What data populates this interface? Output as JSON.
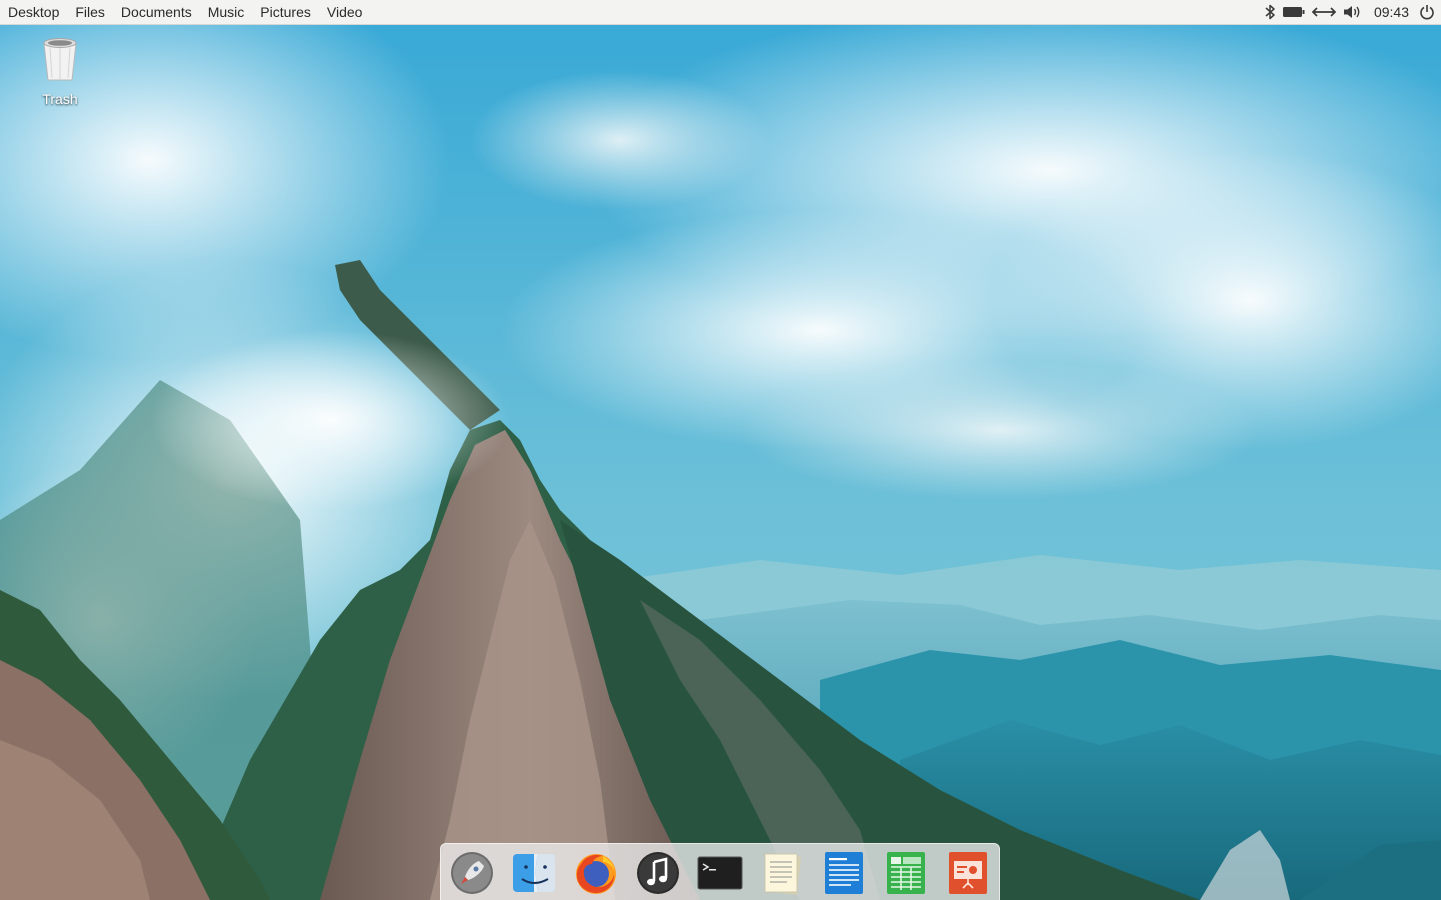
{
  "topbar": {
    "places": [
      {
        "label": "Desktop"
      },
      {
        "label": "Files"
      },
      {
        "label": "Documents"
      },
      {
        "label": "Music"
      },
      {
        "label": "Pictures"
      },
      {
        "label": "Video"
      }
    ],
    "tray_icons": [
      "bluetooth-icon",
      "battery-icon",
      "network-icon",
      "volume-icon",
      "power-icon"
    ],
    "clock": "09:43"
  },
  "desktop": {
    "icons": [
      {
        "label": "Trash",
        "icon": "trash-icon"
      }
    ]
  },
  "dock": {
    "apps": [
      {
        "name": "launcher",
        "icon": "rocket-icon"
      },
      {
        "name": "files",
        "icon": "finder-icon"
      },
      {
        "name": "firefox",
        "icon": "firefox-icon"
      },
      {
        "name": "music",
        "icon": "music-icon"
      },
      {
        "name": "terminal",
        "icon": "terminal-icon"
      },
      {
        "name": "text-editor",
        "icon": "notes-icon"
      },
      {
        "name": "writer",
        "icon": "document-icon"
      },
      {
        "name": "spreadsheet",
        "icon": "spreadsheet-icon"
      },
      {
        "name": "presentation",
        "icon": "presentation-icon"
      }
    ]
  },
  "colors": {
    "panel_bg": "#f3f3f2",
    "sky": "#3aa6cf",
    "mountain_haze": "#2f8fa8"
  }
}
